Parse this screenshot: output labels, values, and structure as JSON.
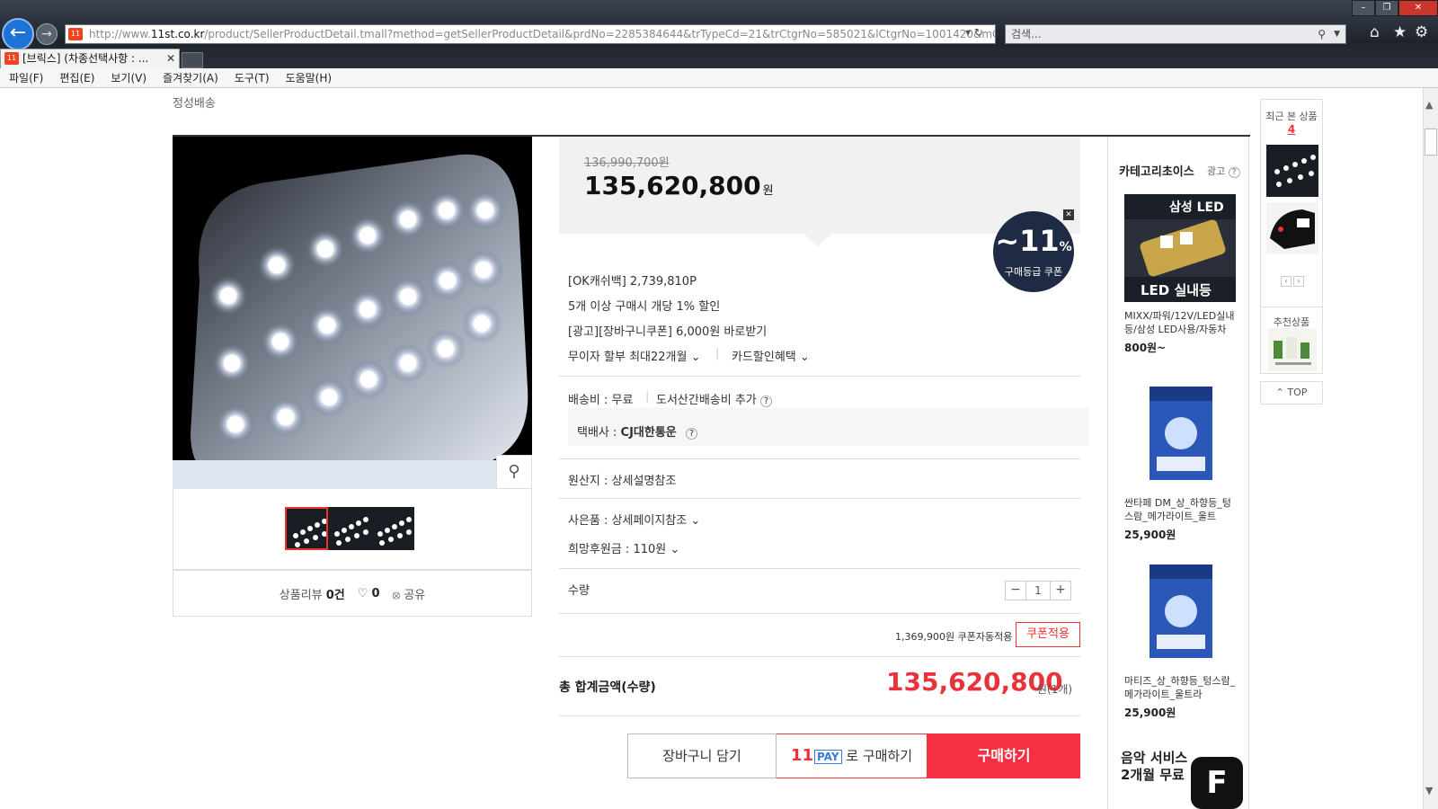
{
  "browser": {
    "url_prefix": "http://www.",
    "url_domain": "11st.co.kr",
    "url_rest": "/product/SellerProductDetail.tmall?method=getSellerProductDetail&prdNo=2285384644&trTypeCd=21&trCtgrNo=585021&lCtgrNo=1001420&mCtgrNo=10",
    "search_placeholder": "검색...",
    "tab_title": "[브릭스] (차종선택사항 : ...",
    "favicon_text": "11",
    "menu": [
      "파일(F)",
      "편집(E)",
      "보기(V)",
      "즐겨찾기(A)",
      "도구(T)",
      "도움말(H)"
    ]
  },
  "product": {
    "breadcrumb": "정성배송",
    "old_price": "136,990,700원",
    "price": "135,620,800",
    "price_unit": "원",
    "coupon_pct": "~11",
    "coupon_pct_sign": "%",
    "coupon_label": "구매등급 쿠폰",
    "ok_cashbag": "[OK캐쉬백] 2,739,810P",
    "bulk_discount": "5개 이상 구매시 개당 1% 할인",
    "cart_coupon": "[광고][장바구니쿠폰] 6,000원 바로받기",
    "installment": "무이자 할부 최대22개월",
    "card_discount": "카드할인혜택",
    "shipping_fee": "배송비 : 무료",
    "island_fee": "도서산간배송비 추가",
    "courier_label": "택배사 : ",
    "courier": "CJ대한통운",
    "origin": "원산지 : 상세설명참조",
    "gift": "사은품 : 상세페이지참조",
    "donation": "희망후원금 : 110원",
    "qty_label": "수량",
    "qty_value": "1",
    "auto_coupon": "1,369,900원 쿠폰자동적용",
    "coupon_apply": "쿠폰적용",
    "total_label": "총 합계금액(수량)",
    "total_price": "135,620,800",
    "total_unit": "원(1개)",
    "btn_cart": "장바구니 담기",
    "btn_pay_logo": "11",
    "btn_pay_logo_tag": "PAY",
    "btn_pay_text": "로 구매하기",
    "btn_buy": "구매하기"
  },
  "reviews": {
    "label": "상품리뷰 ",
    "count": "0건",
    "likes": "0",
    "share": "공유"
  },
  "sidebar": {
    "title": "카테고리초이스",
    "ad_label": "광고",
    "items": [
      {
        "name": "MIXX/파워/12V/LED실내등/삼성 LED사용/자동차",
        "price": "800원~",
        "img_text1": "삼성 LED",
        "img_text2": "LED 실내등"
      },
      {
        "name": "싼타페 DM_상_하향등_텅스람_메가라이트_울트",
        "price": "25,900원"
      },
      {
        "name": "마티즈_상_하향등_텅스람_메가라이트_울트라",
        "price": "25,900원"
      }
    ],
    "music_line1": "음악 서비스",
    "music_line2": "2개월 무료",
    "music_logo": "F"
  },
  "recent": {
    "title": "최근 본 상품",
    "count": "4",
    "recommend": "추천상품",
    "top": "TOP"
  },
  "colors": {
    "accent_red": "#e8323c",
    "coupon_navy": "#1f2a44"
  }
}
